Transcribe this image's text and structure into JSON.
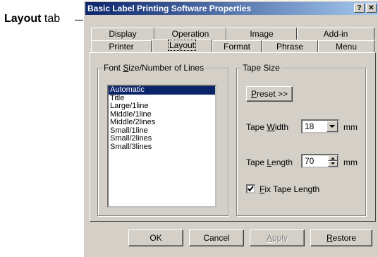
{
  "callout": {
    "bold": "Layout",
    "rest": " tab"
  },
  "dialog": {
    "title": "Basic Label Printing Software Properties",
    "help_label": "?",
    "close_label": "✕"
  },
  "tabs_back": [
    {
      "label": "Display"
    },
    {
      "label": "Operation"
    },
    {
      "label": "Image"
    },
    {
      "label": "Add-in"
    }
  ],
  "tabs_front": [
    {
      "label": "Printer"
    },
    {
      "label": "Layout"
    },
    {
      "label": "Format"
    },
    {
      "label": "Phrase"
    },
    {
      "label": "Menu"
    }
  ],
  "font_group": {
    "label_pre": "Font ",
    "label_u": "S",
    "label_post": "ize/Number of Lines",
    "items": [
      "Automatic",
      "Title",
      "Large/1line",
      "Middle/1line",
      "Middle/2lines",
      "Small/1line",
      "Small/2lines",
      "Small/3lines"
    ],
    "selected": "Automatic"
  },
  "tape_group": {
    "label": "Tape Size",
    "preset_u": "P",
    "preset_rest": "reset >>",
    "width_pre": "Tape ",
    "width_u": "W",
    "width_post": "idth",
    "width_value": "18",
    "width_unit": "mm",
    "length_pre": "Tape ",
    "length_u": "L",
    "length_post": "ength",
    "length_value": "70",
    "length_unit": "mm",
    "fix_u": "F",
    "fix_rest": "ix Tape Length",
    "fix_checked": true
  },
  "buttons": {
    "ok": "OK",
    "cancel": "Cancel",
    "apply_u": "A",
    "apply_rest": "pply",
    "restore_u": "R",
    "restore_rest": "estore"
  }
}
